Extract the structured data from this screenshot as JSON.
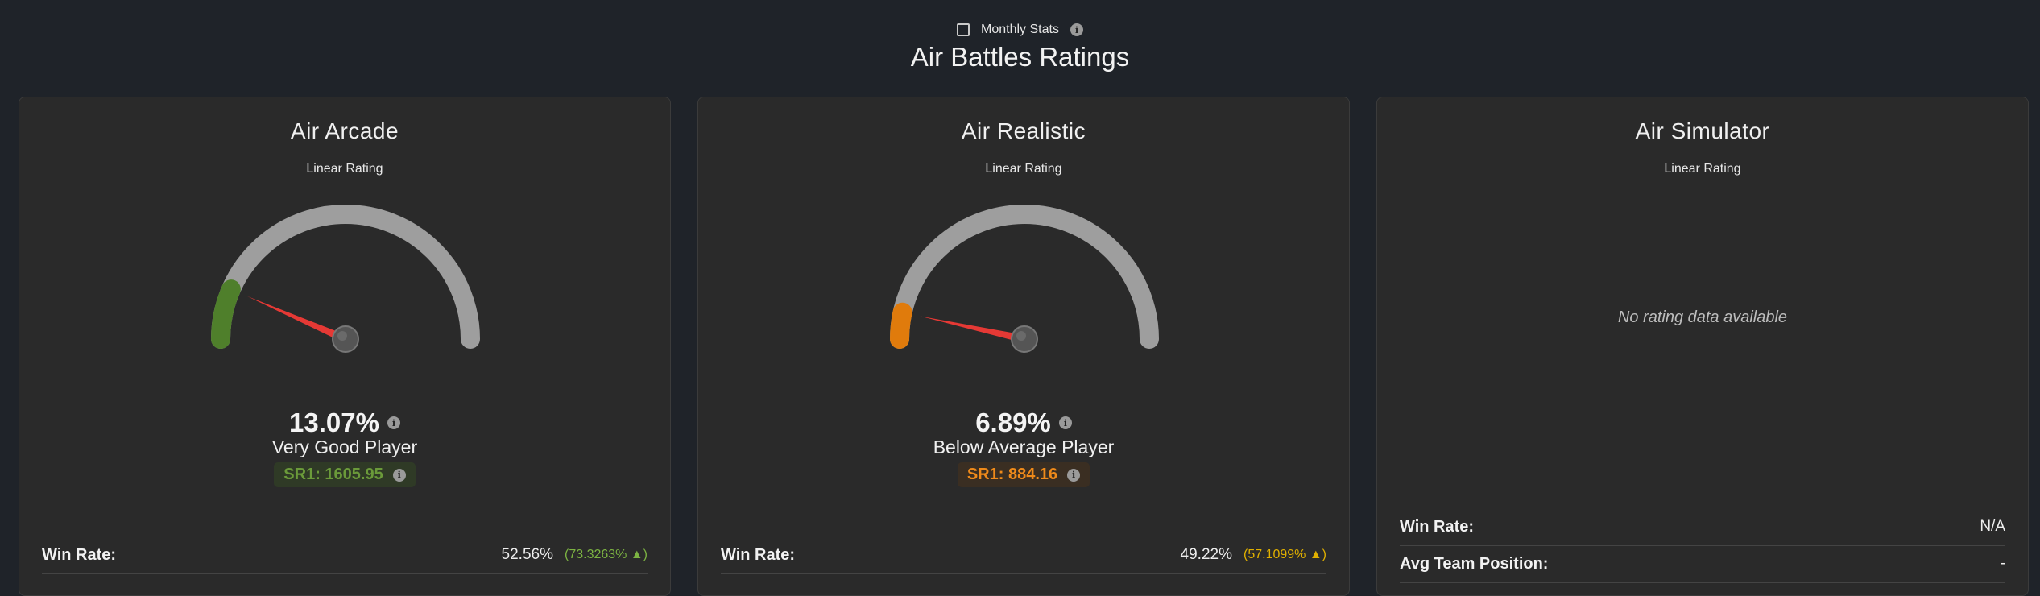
{
  "header": {
    "monthly_label": "Monthly Stats",
    "title": "Air Battles Ratings"
  },
  "colors": {
    "background": "#1f2329",
    "card": "#2a2a2a",
    "gauge_track": "#9e9e9e",
    "needle": "#e53935",
    "good_green": "#5a8a32",
    "below_orange": "#e07b0c",
    "positive_arrow": "#4caf50"
  },
  "cards": [
    {
      "title": "Air Arcade",
      "subtitle": "Linear Rating",
      "percentage": "13.07%",
      "percent_value": 13.07,
      "level_color": "#4f7f2b",
      "player_label": "Very Good Player",
      "sr_text": "SR1: 1605.95",
      "sr_color": "#6b9a3a",
      "sr_bg": "#2f3a26",
      "win_rate_label": "Win Rate:",
      "win_rate_value": "52.56%",
      "win_rate_change": "(73.3263% ▲)",
      "change_color": "#7cb342"
    },
    {
      "title": "Air Realistic",
      "subtitle": "Linear Rating",
      "percentage": "6.89%",
      "percent_value": 6.89,
      "level_color": "#e07b0c",
      "player_label": "Below Average Player",
      "sr_text": "SR1: 884.16",
      "sr_color": "#ef8a1a",
      "sr_bg": "#3a2e22",
      "win_rate_label": "Win Rate:",
      "win_rate_value": "49.22%",
      "win_rate_change": "(57.1099% ▲)",
      "change_color": "#e0b000"
    },
    {
      "title": "Air Simulator",
      "subtitle": "Linear Rating",
      "no_data": "No rating data available",
      "win_rate_label": "Win Rate:",
      "win_rate_value": "N/A",
      "avg_team_label": "Avg Team Position:",
      "avg_team_value": "-"
    }
  ]
}
